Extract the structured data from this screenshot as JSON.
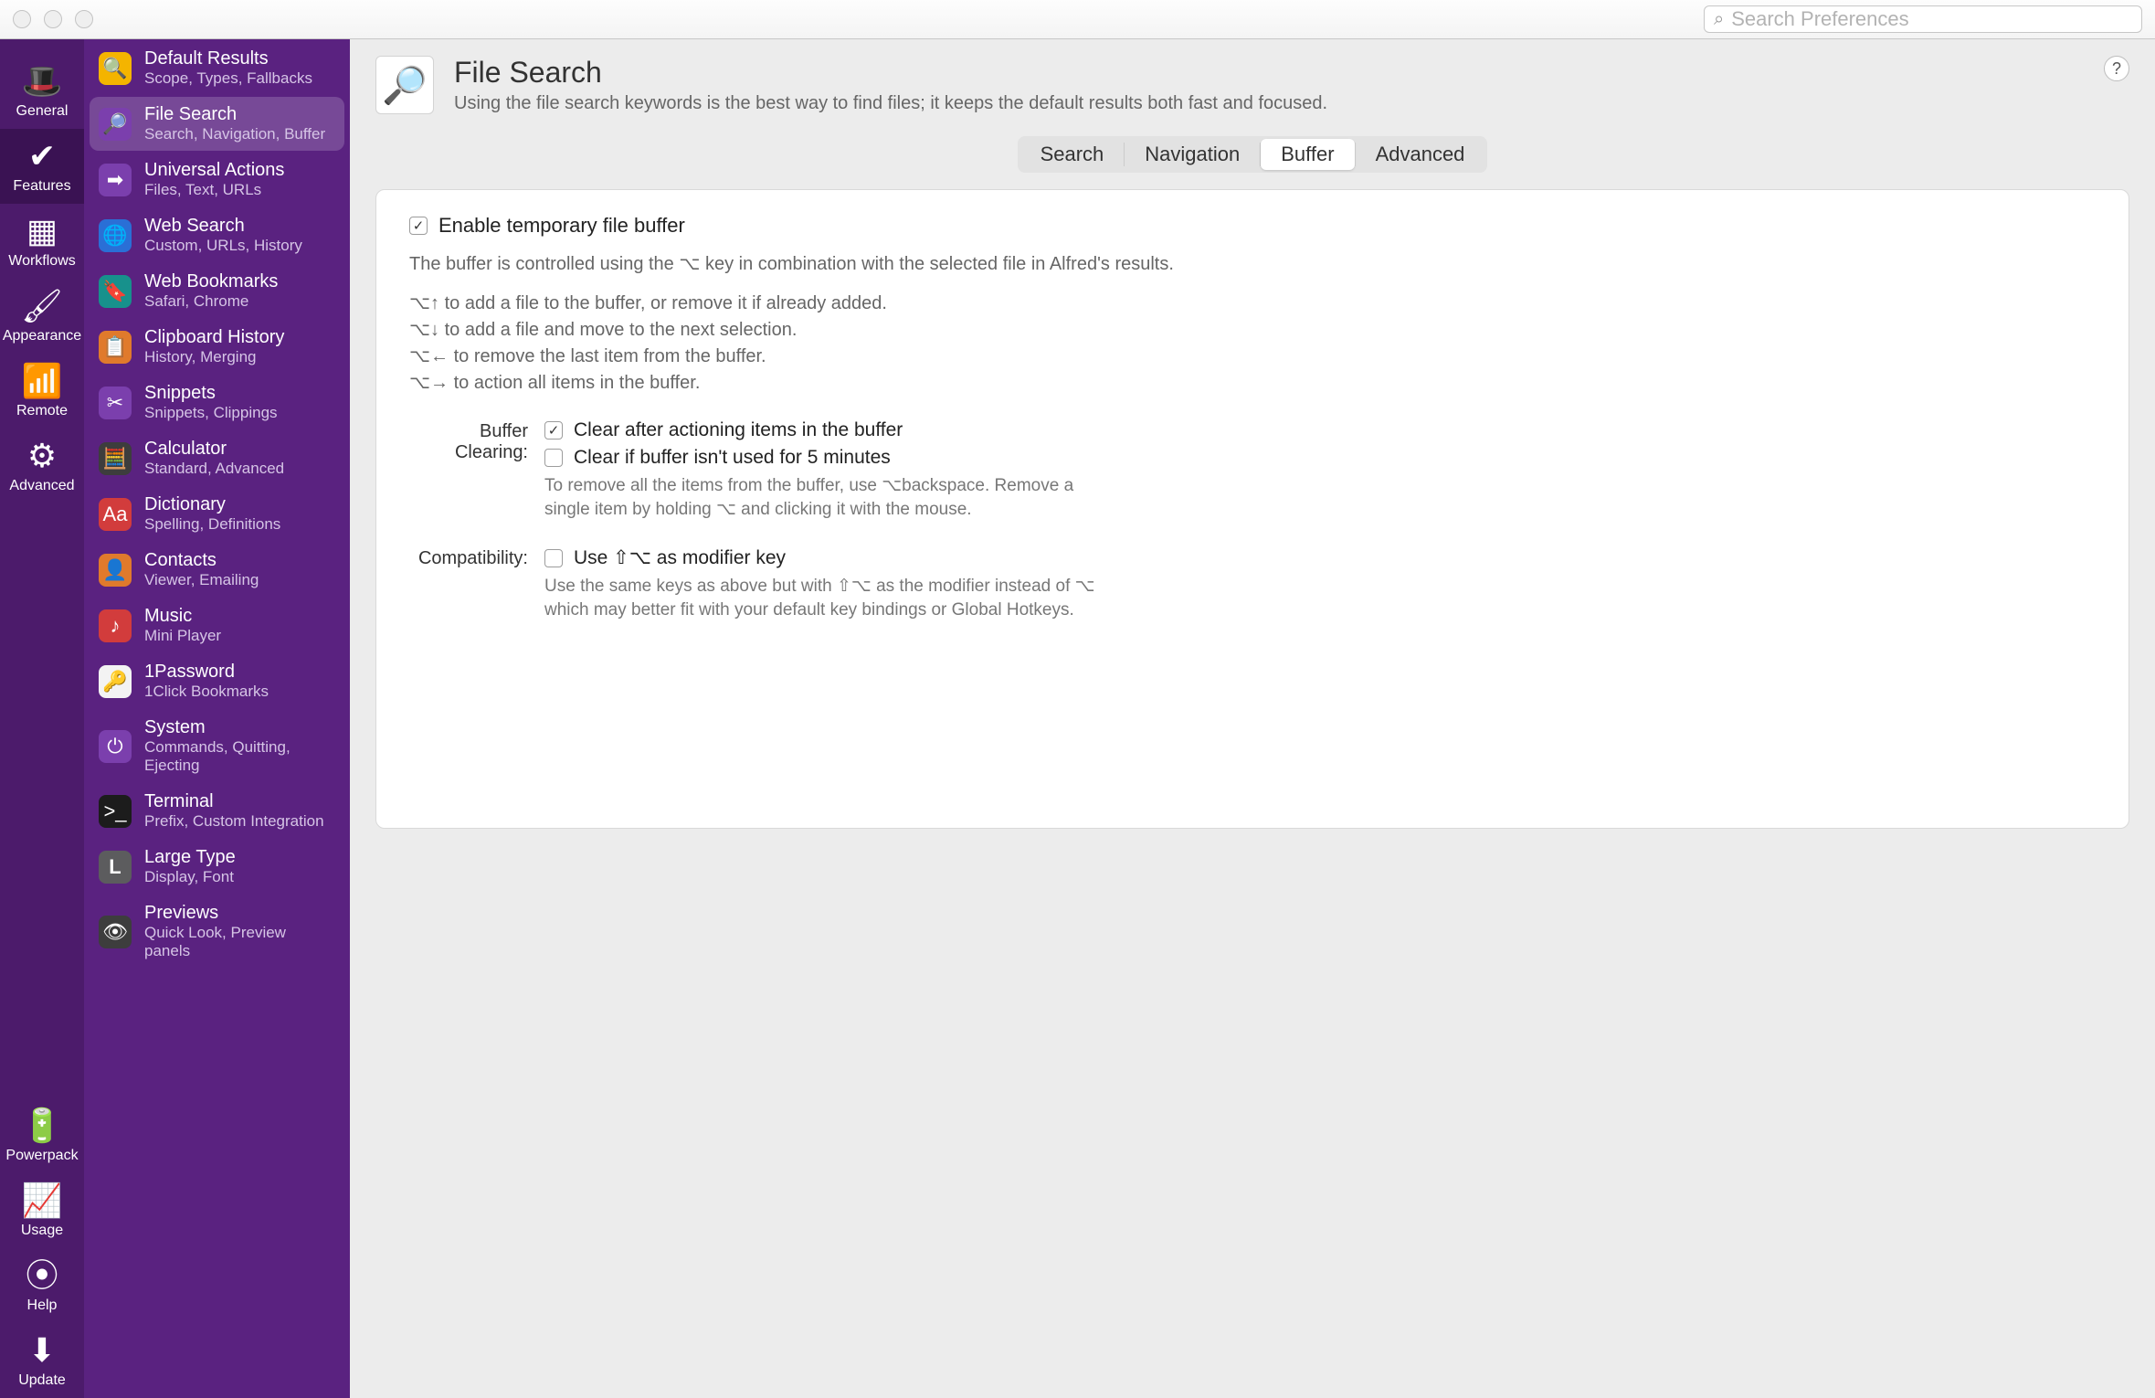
{
  "search_placeholder": "Search Preferences",
  "rail": [
    {
      "id": "general",
      "label": "General",
      "glyph": "🎩"
    },
    {
      "id": "features",
      "label": "Features",
      "glyph": "✔"
    },
    {
      "id": "workflows",
      "label": "Workflows",
      "glyph": "▦"
    },
    {
      "id": "appearance",
      "label": "Appearance",
      "glyph": "🖌"
    },
    {
      "id": "remote",
      "label": "Remote",
      "glyph": "📶"
    },
    {
      "id": "advanced",
      "label": "Advanced",
      "glyph": "⚙"
    }
  ],
  "rail_bottom": [
    {
      "id": "powerpack",
      "label": "Powerpack",
      "glyph": "🔋"
    },
    {
      "id": "usage",
      "label": "Usage",
      "glyph": "📈"
    },
    {
      "id": "help",
      "label": "Help",
      "glyph": "⦿"
    },
    {
      "id": "update",
      "label": "Update",
      "glyph": "⬇"
    }
  ],
  "features": [
    {
      "id": "default-results",
      "title": "Default Results",
      "sub": "Scope, Types, Fallbacks",
      "glyph": "🔍",
      "bg": "bg-yellow"
    },
    {
      "id": "file-search",
      "title": "File Search",
      "sub": "Search, Navigation, Buffer",
      "glyph": "🔎",
      "bg": "bg-purple"
    },
    {
      "id": "universal-actions",
      "title": "Universal Actions",
      "sub": "Files, Text, URLs",
      "glyph": "➡",
      "bg": "bg-purple"
    },
    {
      "id": "web-search",
      "title": "Web Search",
      "sub": "Custom, URLs, History",
      "glyph": "🌐",
      "bg": "bg-blue"
    },
    {
      "id": "web-bookmarks",
      "title": "Web Bookmarks",
      "sub": "Safari, Chrome",
      "glyph": "🔖",
      "bg": "bg-teal"
    },
    {
      "id": "clipboard-history",
      "title": "Clipboard History",
      "sub": "History, Merging",
      "glyph": "📋",
      "bg": "bg-orange"
    },
    {
      "id": "snippets",
      "title": "Snippets",
      "sub": "Snippets, Clippings",
      "glyph": "✂",
      "bg": "bg-purple"
    },
    {
      "id": "calculator",
      "title": "Calculator",
      "sub": "Standard, Advanced",
      "glyph": "🧮",
      "bg": "bg-dark"
    },
    {
      "id": "dictionary",
      "title": "Dictionary",
      "sub": "Spelling, Definitions",
      "glyph": "Aa",
      "bg": "bg-red"
    },
    {
      "id": "contacts",
      "title": "Contacts",
      "sub": "Viewer, Emailing",
      "glyph": "👤",
      "bg": "bg-orange"
    },
    {
      "id": "music",
      "title": "Music",
      "sub": "Mini Player",
      "glyph": "♪",
      "bg": "bg-red"
    },
    {
      "id": "1password",
      "title": "1Password",
      "sub": "1Click Bookmarks",
      "glyph": "🔑",
      "bg": "bg-white"
    },
    {
      "id": "system",
      "title": "System",
      "sub": "Commands, Quitting, Ejecting",
      "glyph": "⏻",
      "bg": "bg-purple"
    },
    {
      "id": "terminal",
      "title": "Terminal",
      "sub": "Prefix, Custom Integration",
      "glyph": ">_",
      "bg": "bg-black"
    },
    {
      "id": "large-type",
      "title": "Large Type",
      "sub": "Display, Font",
      "glyph": "L",
      "bg": "bg-l"
    },
    {
      "id": "previews",
      "title": "Previews",
      "sub": "Quick Look, Preview panels",
      "glyph": "👁",
      "bg": "bg-eye"
    }
  ],
  "header": {
    "title": "File Search",
    "subtitle": "Using the file search keywords is the best way to find files; it keeps the default results both fast and focused."
  },
  "tabs": [
    "Search",
    "Navigation",
    "Buffer",
    "Advanced"
  ],
  "active_tab": 2,
  "pane": {
    "enable_label": "Enable temporary file buffer",
    "enable_checked": true,
    "intro": "The buffer is controlled using the ⌥ key in combination with the selected file in Alfred's results.",
    "shortcuts": [
      "⌥↑ to add a file to the buffer, or remove it if already added.",
      "⌥↓ to add a file and move to the next selection.",
      "⌥← to remove the last item from the buffer.",
      "⌥→ to action all items in the buffer."
    ],
    "buffer_clearing_label": "Buffer Clearing:",
    "clear_after_label": "Clear after actioning items in the buffer",
    "clear_after_checked": true,
    "clear_idle_label": "Clear if buffer isn't used for 5 minutes",
    "clear_idle_checked": false,
    "clear_hint": "To remove all the items from the buffer, use ⌥backspace. Remove a single item by holding ⌥ and clicking it with the mouse.",
    "compat_label": "Compatibility:",
    "compat_opt_label": "Use ⇧⌥ as modifier key",
    "compat_opt_checked": false,
    "compat_hint": "Use the same keys as above but with ⇧⌥ as the modifier instead of ⌥ which may better fit with your default key bindings or Global Hotkeys."
  }
}
